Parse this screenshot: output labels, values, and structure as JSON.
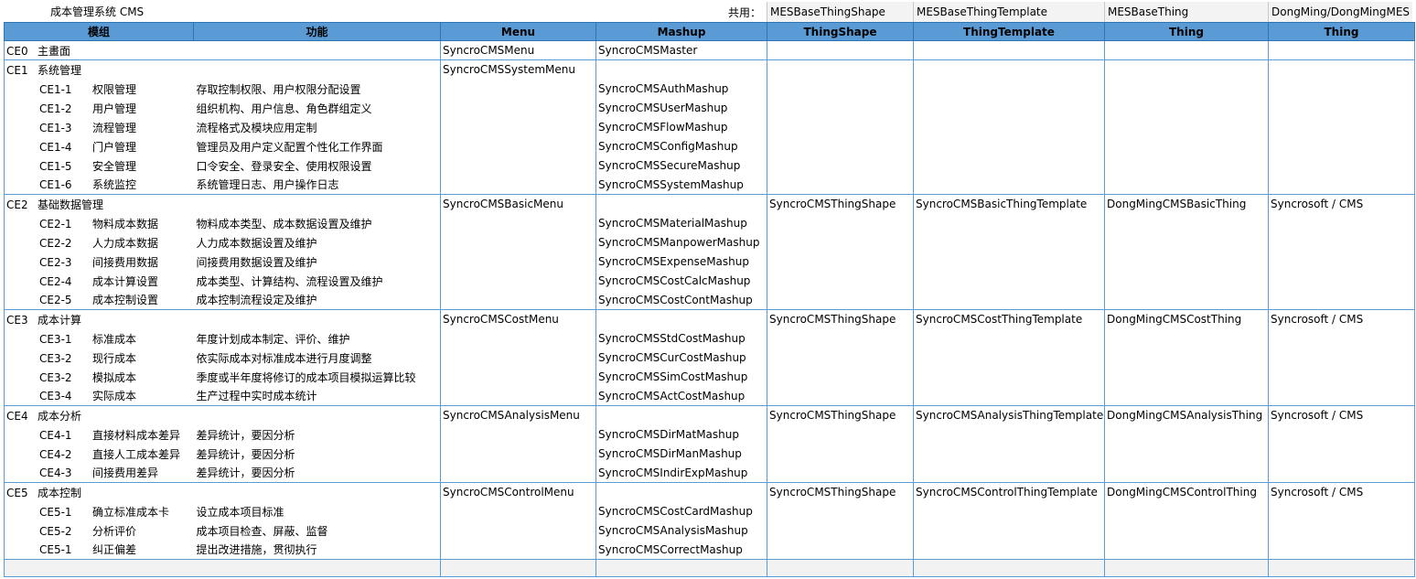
{
  "top": {
    "title": "成本管理系统 CMS",
    "shared_label": "共用：",
    "shared": [
      "MESBaseThingShape",
      "MESBaseThingTemplate",
      "MESBaseThing",
      "DongMing/DongMingMES"
    ]
  },
  "headers": {
    "module": "模组",
    "function": "功能",
    "menu": "Menu",
    "mashup": "Mashup",
    "thingshape": "ThingShape",
    "thingtemplate": "ThingTemplate",
    "thing": "Thing",
    "thing2": "Thing"
  },
  "groups": [
    {
      "code": "CE0",
      "name": "主畫面",
      "menu": "SyncroCMSMenu",
      "mashup": "SyncroCMSMaster",
      "thingshape": "",
      "thingtemplate": "",
      "thing": "",
      "thing2": "",
      "items": []
    },
    {
      "code": "CE1",
      "name": "系统管理",
      "menu": "SyncroCMSSystemMenu",
      "mashup": "",
      "thingshape": "",
      "thingtemplate": "",
      "thing": "",
      "thing2": "",
      "items": [
        {
          "code": "CE1-1",
          "name": "权限管理",
          "func": "存取控制权限、用户权限分配设置",
          "mashup": "SyncroCMSAuthMashup"
        },
        {
          "code": "CE1-2",
          "name": "用户管理",
          "func": "组织机构、用户信息、角色群组定义",
          "mashup": "SyncroCMSUserMashup"
        },
        {
          "code": "CE1-3",
          "name": "流程管理",
          "func": "流程格式及模块应用定制",
          "mashup": "SyncroCMSFlowMashup"
        },
        {
          "code": "CE1-4",
          "name": "门户管理",
          "func": "管理员及用户定义配置个性化工作界面",
          "mashup": "SyncroCMSConfigMashup"
        },
        {
          "code": "CE1-5",
          "name": "安全管理",
          "func": "口令安全、登录安全、使用权限设置",
          "mashup": "SyncroCMSSecureMashup"
        },
        {
          "code": "CE1-6",
          "name": "系统监控",
          "func": "系统管理日志、用户操作日志",
          "mashup": "SyncroCMSSystemMashup"
        }
      ]
    },
    {
      "code": "CE2",
      "name": "基础数据管理",
      "menu": "SyncroCMSBasicMenu",
      "mashup": "",
      "thingshape": "SyncroCMSThingShape",
      "thingtemplate": "SyncroCMSBasicThingTemplate",
      "thing": "DongMingCMSBasicThing",
      "thing2": "Syncrosoft / CMS",
      "items": [
        {
          "code": "CE2-1",
          "name": "物料成本数据",
          "func": "物料成本类型、成本数据设置及维护",
          "mashup": "SyncroCMSMaterialMashup"
        },
        {
          "code": "CE2-2",
          "name": "人力成本数据",
          "func": "人力成本数据设置及维护",
          "mashup": "SyncroCMSManpowerMashup"
        },
        {
          "code": "CE2-3",
          "name": "间接费用数据",
          "func": "间接费用数据设置及维护",
          "mashup": "SyncroCMSExpenseMashup"
        },
        {
          "code": "CE2-4",
          "name": "成本计算设置",
          "func": "成本类型、计算结构、流程设置及维护",
          "mashup": "SyncroCMSCostCalcMashup"
        },
        {
          "code": "CE2-5",
          "name": "成本控制设置",
          "func": "成本控制流程设定及维护",
          "mashup": "SyncroCMSCostContMashup"
        }
      ]
    },
    {
      "code": "CE3",
      "name": "成本计算",
      "menu": "SyncroCMSCostMenu",
      "mashup": "",
      "thingshape": "SyncroCMSThingShape",
      "thingtemplate": "SyncroCMSCostThingTemplate",
      "thing": "DongMingCMSCostThing",
      "thing2": "Syncrosoft / CMS",
      "items": [
        {
          "code": "CE3-1",
          "name": "标准成本",
          "func": "年度计划成本制定、评价、维护",
          "mashup": "SyncroCMSStdCostMashup"
        },
        {
          "code": "CE3-2",
          "name": "现行成本",
          "func": "依实际成本对标准成本进行月度调整",
          "mashup": "SyncroCMSCurCostMashup"
        },
        {
          "code": "CE3-2",
          "name": "模拟成本",
          "func": "季度或半年度将修订的成本项目模拟运算比较",
          "mashup": "SyncroCMSSimCostMashup"
        },
        {
          "code": "CE3-4",
          "name": "实际成本",
          "func": "生产过程中实时成本统计",
          "mashup": "SyncroCMSActCostMashup"
        }
      ]
    },
    {
      "code": "CE4",
      "name": "成本分析",
      "menu": "SyncroCMSAnalysisMenu",
      "mashup": "",
      "thingshape": "SyncroCMSThingShape",
      "thingtemplate": "SyncroCMSAnalysisThingTemplate",
      "thing": "DongMingCMSAnalysisThing",
      "thing2": "Syncrosoft / CMS",
      "items": [
        {
          "code": "CE4-1",
          "name": "直接材料成本差异",
          "func": "差异统计，要因分析",
          "mashup": "SyncroCMSDirMatMashup"
        },
        {
          "code": "CE4-2",
          "name": "直接人工成本差异",
          "func": "差异统计，要因分析",
          "mashup": "SyncroCMSDirManMashup"
        },
        {
          "code": "CE4-3",
          "name": "间接费用差异",
          "func": "差异统计，要因分析",
          "mashup": "SyncroCMSIndirExpMashup"
        }
      ]
    },
    {
      "code": "CE5",
      "name": "成本控制",
      "menu": "SyncroCMSControlMenu",
      "mashup": "",
      "thingshape": "SyncroCMSThingShape",
      "thingtemplate": "SyncroCMSControlThingTemplate",
      "thing": "DongMingCMSControlThing",
      "thing2": "Syncrosoft / CMS",
      "items": [
        {
          "code": "CE5-1",
          "name": "确立标准成本卡",
          "func": "设立成本项目标准",
          "mashup": "SyncroCMSCostCardMashup"
        },
        {
          "code": "CE5-2",
          "name": "分析评价",
          "func": "成本项目检查、屏蔽、监督",
          "mashup": "SyncroCMSAnalysisMashup"
        },
        {
          "code": "CE5-1",
          "name": "纠正偏差",
          "func": "提出改进措施，贯彻执行",
          "mashup": "SyncroCMSCorrectMashup"
        }
      ]
    }
  ]
}
